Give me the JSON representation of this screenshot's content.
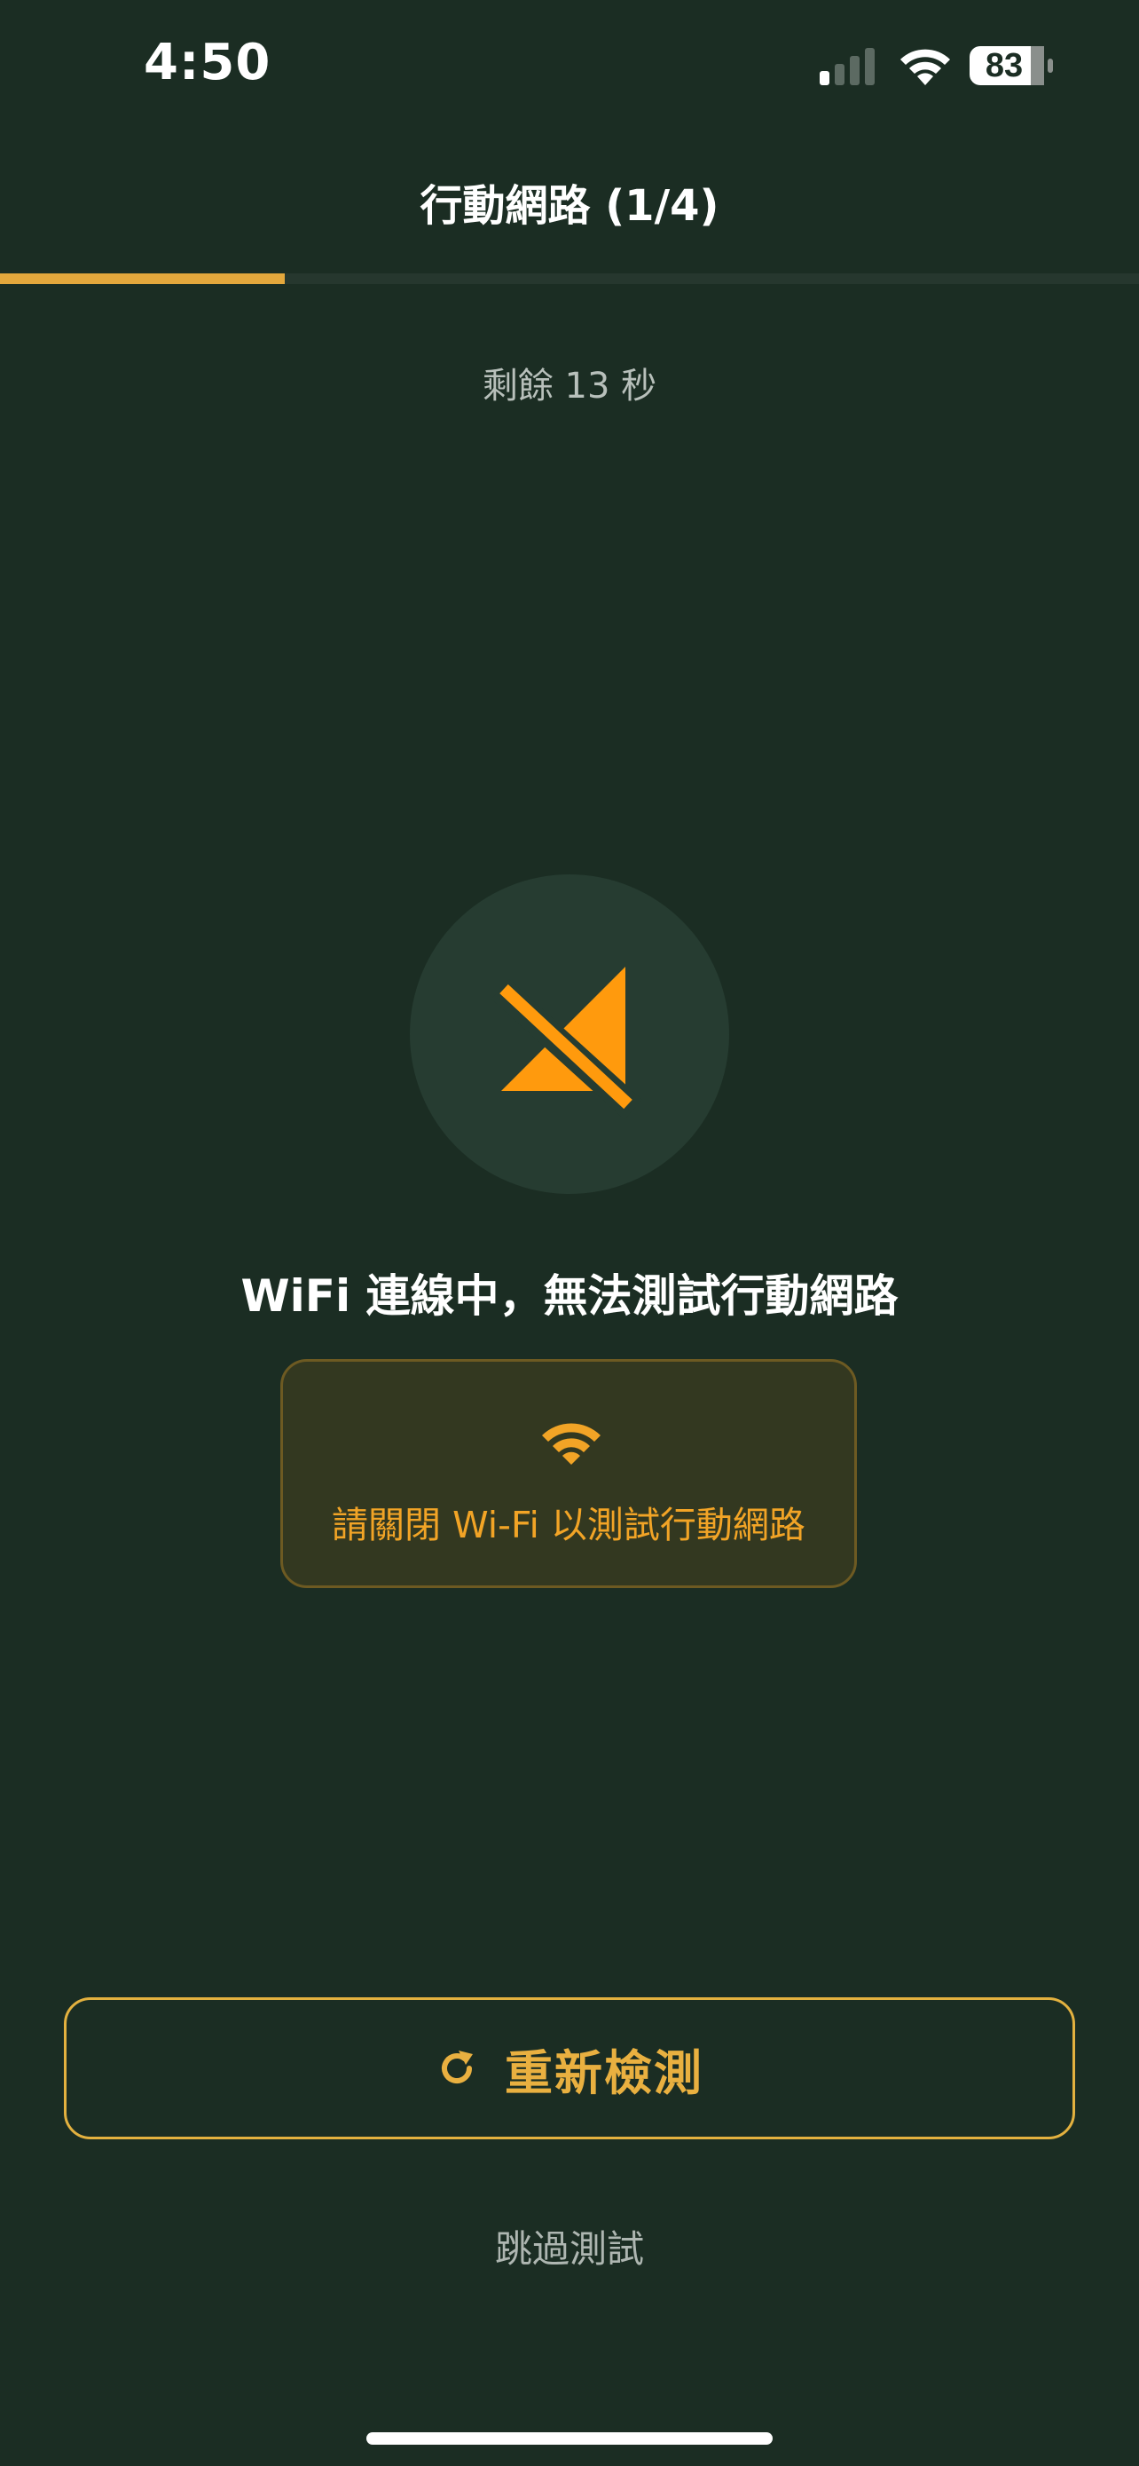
{
  "status_bar": {
    "time": "4:50",
    "battery_level": "83",
    "signal_bars_active": 1,
    "signal_bars_total": 4,
    "icons": [
      "cellular-signal-icon",
      "wifi-icon",
      "battery-icon"
    ]
  },
  "header": {
    "title": "行動網路 (1/4)",
    "progress_fraction": 0.25,
    "progress_color": "#e3a73c"
  },
  "countdown": {
    "text": "剩餘 13 秒"
  },
  "status": {
    "icon": "cellular-off-icon",
    "icon_color": "#ff9a0d",
    "message": "WiFi 連線中，無法測試行動網路"
  },
  "hint": {
    "icon": "wifi-icon",
    "text": "請關閉 Wi-Fi 以測試行動網路"
  },
  "actions": {
    "retry_label": "重新檢測",
    "retry_icon": "refresh-icon",
    "skip_label": "跳過測試"
  },
  "colors": {
    "background": "#1b2d23",
    "accent": "#e3b13f",
    "warning": "#f2a426"
  }
}
